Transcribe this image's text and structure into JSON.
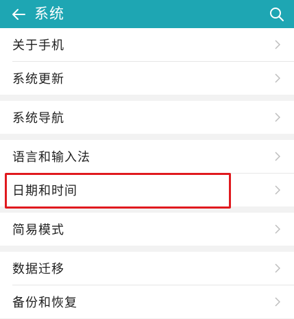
{
  "header": {
    "title": "系统",
    "back_icon": "back-arrow-icon",
    "search_icon": "search-icon",
    "accent_color": "#1ea6b3"
  },
  "groups": [
    {
      "items": [
        {
          "label": "关于手机"
        },
        {
          "label": "系统更新"
        }
      ]
    },
    {
      "items": [
        {
          "label": "系统导航"
        }
      ]
    },
    {
      "items": [
        {
          "label": "语言和输入法"
        },
        {
          "label": "日期和时间"
        }
      ]
    },
    {
      "items": [
        {
          "label": "简易模式"
        }
      ]
    },
    {
      "items": [
        {
          "label": "数据迁移"
        },
        {
          "label": "备份和恢复"
        }
      ]
    }
  ],
  "highlight": {
    "target": "日期和时间",
    "color": "#e0191e"
  }
}
